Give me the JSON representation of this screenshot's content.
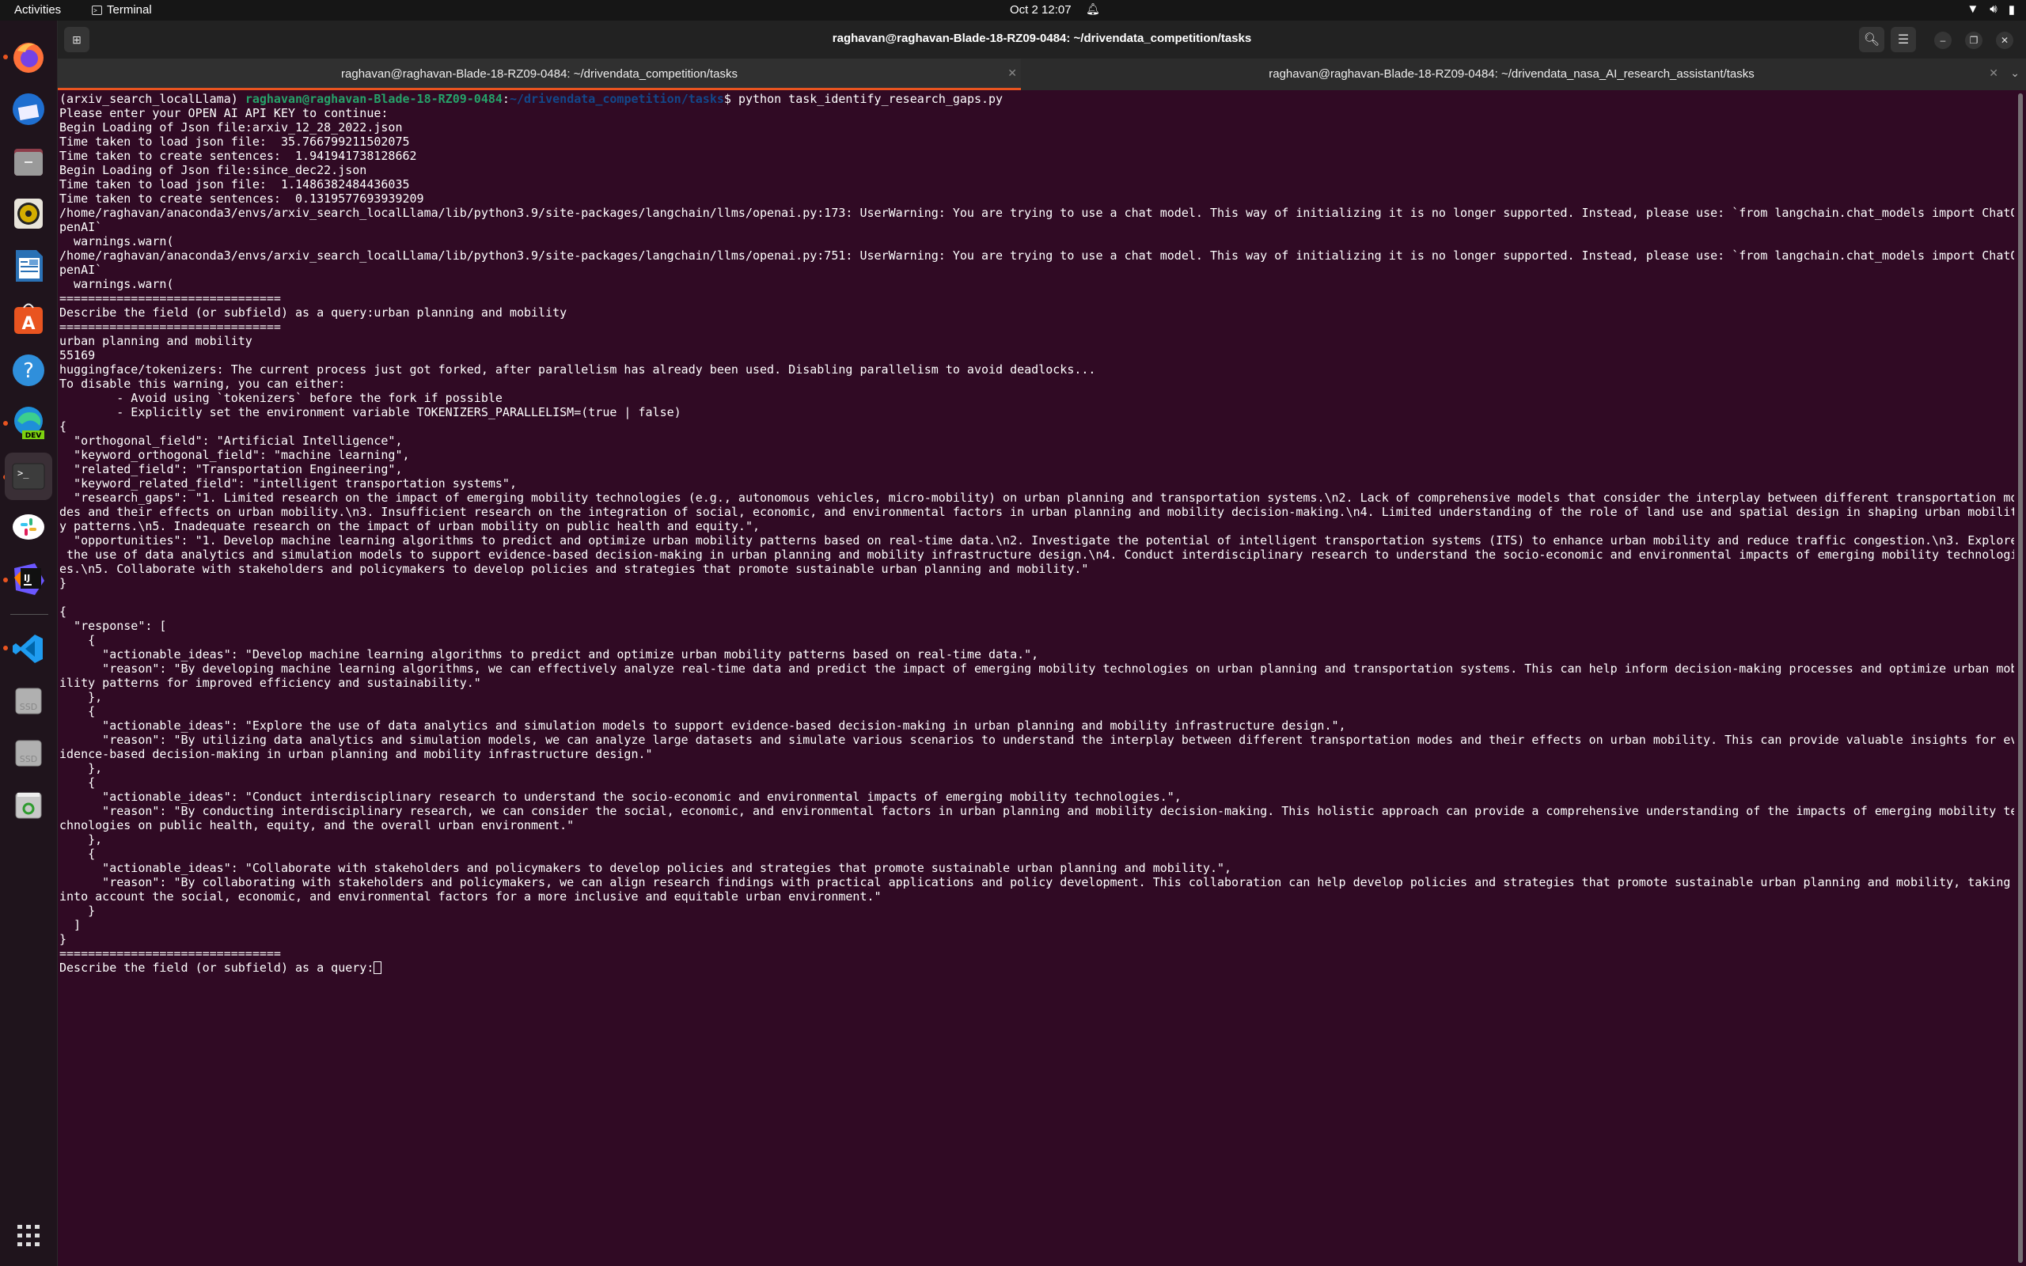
{
  "topbar": {
    "activities": "Activities",
    "app_name": "Terminal",
    "clock": "Oct 2  12:07",
    "tray_icons": [
      "wifi-icon",
      "volume-icon",
      "battery-icon"
    ]
  },
  "dock": {
    "items": [
      {
        "name": "firefox",
        "running": true
      },
      {
        "name": "thunderbird",
        "running": false
      },
      {
        "name": "files",
        "running": false
      },
      {
        "name": "rhythmbox",
        "running": false
      },
      {
        "name": "libreoffice-writer",
        "running": false
      },
      {
        "name": "app-center",
        "running": false
      },
      {
        "name": "help",
        "running": false
      },
      {
        "name": "edge-dev",
        "running": true
      },
      {
        "name": "terminal",
        "running": true,
        "active": true
      },
      {
        "name": "slack",
        "running": false
      },
      {
        "name": "intellij-idea",
        "running": true
      },
      {
        "name": "vscode",
        "running": true
      },
      {
        "name": "ssd-drive-1",
        "running": false,
        "label": "SSD"
      },
      {
        "name": "ssd-drive-2",
        "running": false,
        "label": "SSD"
      },
      {
        "name": "trash",
        "running": false
      }
    ],
    "show_apps_icon": "grid-icon"
  },
  "window": {
    "title": "raghavan@raghavan-Blade-18-RZ09-0484: ~/drivendata_competition/tasks",
    "tabs": [
      {
        "label": "raghavan@raghavan-Blade-18-RZ09-0484: ~/drivendata_competition/tasks",
        "active": true
      },
      {
        "label": "raghavan@raghavan-Blade-18-RZ09-0484: ~/drivendata_nasa_AI_research_assistant/tasks",
        "active": false
      }
    ]
  },
  "terminal": {
    "prompt": {
      "env": "(arxiv_search_localLlama) ",
      "user_host": "raghavan@raghavan-Blade-18-RZ09-0484",
      "sep": ":",
      "path": "~/drivendata_competition/tasks",
      "dollar": "$ ",
      "command": "python task_identify_research_gaps.py"
    },
    "lines": [
      "Please enter your OPEN AI API KEY to continue:",
      "Begin Loading of Json file:arxiv_12_28_2022.json",
      "Time taken to load json file:  35.766799211502075",
      "Time taken to create sentences:  1.941941738128662",
      "Begin Loading of Json file:since_dec22.json",
      "Time taken to load json file:  1.1486382484436035",
      "Time taken to create sentences:  0.1319577693939209",
      "/home/raghavan/anaconda3/envs/arxiv_search_localLlama/lib/python3.9/site-packages/langchain/llms/openai.py:173: UserWarning: You are trying to use a chat model. This way of initializing it is no longer supported. Instead, please use: `from langchain.chat_models import ChatO",
      "penAI`",
      "  warnings.warn(",
      "/home/raghavan/anaconda3/envs/arxiv_search_localLlama/lib/python3.9/site-packages/langchain/llms/openai.py:751: UserWarning: You are trying to use a chat model. This way of initializing it is no longer supported. Instead, please use: `from langchain.chat_models import ChatO",
      "penAI`",
      "  warnings.warn(",
      "===============================",
      "Describe the field (or subfield) as a query:urban planning and mobility",
      "===============================",
      "urban planning and mobility",
      "55169",
      "huggingface/tokenizers: The current process just got forked, after parallelism has already been used. Disabling parallelism to avoid deadlocks...",
      "To disable this warning, you can either:",
      "\t- Avoid using `tokenizers` before the fork if possible",
      "\t- Explicitly set the environment variable TOKENIZERS_PARALLELISM=(true | false)",
      "{",
      "  \"orthogonal_field\": \"Artificial Intelligence\",",
      "  \"keyword_orthogonal_field\": \"machine learning\",",
      "  \"related_field\": \"Transportation Engineering\",",
      "  \"keyword_related_field\": \"intelligent transportation systems\",",
      "  \"research_gaps\": \"1. Limited research on the impact of emerging mobility technologies (e.g., autonomous vehicles, micro-mobility) on urban planning and transportation systems.\\n2. Lack of comprehensive models that consider the interplay between different transportation mo",
      "des and their effects on urban mobility.\\n3. Insufficient research on the integration of social, economic, and environmental factors in urban planning and mobility decision-making.\\n4. Limited understanding of the role of land use and spatial design in shaping urban mobilit",
      "y patterns.\\n5. Inadequate research on the impact of urban mobility on public health and equity.\",",
      "  \"opportunities\": \"1. Develop machine learning algorithms to predict and optimize urban mobility patterns based on real-time data.\\n2. Investigate the potential of intelligent transportation systems (ITS) to enhance urban mobility and reduce traffic congestion.\\n3. Explore",
      " the use of data analytics and simulation models to support evidence-based decision-making in urban planning and mobility infrastructure design.\\n4. Conduct interdisciplinary research to understand the socio-economic and environmental impacts of emerging mobility technologi",
      "es.\\n5. Collaborate with stakeholders and policymakers to develop policies and strategies that promote sustainable urban planning and mobility.\"",
      "}",
      "",
      "{",
      "  \"response\": [",
      "    {",
      "      \"actionable_ideas\": \"Develop machine learning algorithms to predict and optimize urban mobility patterns based on real-time data.\",",
      "      \"reason\": \"By developing machine learning algorithms, we can effectively analyze real-time data and predict the impact of emerging mobility technologies on urban planning and transportation systems. This can help inform decision-making processes and optimize urban mob",
      "ility patterns for improved efficiency and sustainability.\"",
      "    },",
      "    {",
      "      \"actionable_ideas\": \"Explore the use of data analytics and simulation models to support evidence-based decision-making in urban planning and mobility infrastructure design.\",",
      "      \"reason\": \"By utilizing data analytics and simulation models, we can analyze large datasets and simulate various scenarios to understand the interplay between different transportation modes and their effects on urban mobility. This can provide valuable insights for ev",
      "idence-based decision-making in urban planning and mobility infrastructure design.\"",
      "    },",
      "    {",
      "      \"actionable_ideas\": \"Conduct interdisciplinary research to understand the socio-economic and environmental impacts of emerging mobility technologies.\",",
      "      \"reason\": \"By conducting interdisciplinary research, we can consider the social, economic, and environmental factors in urban planning and mobility decision-making. This holistic approach can provide a comprehensive understanding of the impacts of emerging mobility te",
      "chnologies on public health, equity, and the overall urban environment.\"",
      "    },",
      "    {",
      "      \"actionable_ideas\": \"Collaborate with stakeholders and policymakers to develop policies and strategies that promote sustainable urban planning and mobility.\",",
      "      \"reason\": \"By collaborating with stakeholders and policymakers, we can align research findings with practical applications and policy development. This collaboration can help develop policies and strategies that promote sustainable urban planning and mobility, taking",
      "into account the social, economic, and environmental factors for a more inclusive and equitable urban environment.\"",
      "    }",
      "  ]",
      "}",
      "==============================="
    ],
    "input_prompt": "Describe the field (or subfield) as a query:",
    "input_value": ""
  },
  "colors": {
    "terminal_bg": "#300a24",
    "accent": "#e95420",
    "prompt_user": "#26a269",
    "prompt_path": "#12488b"
  }
}
